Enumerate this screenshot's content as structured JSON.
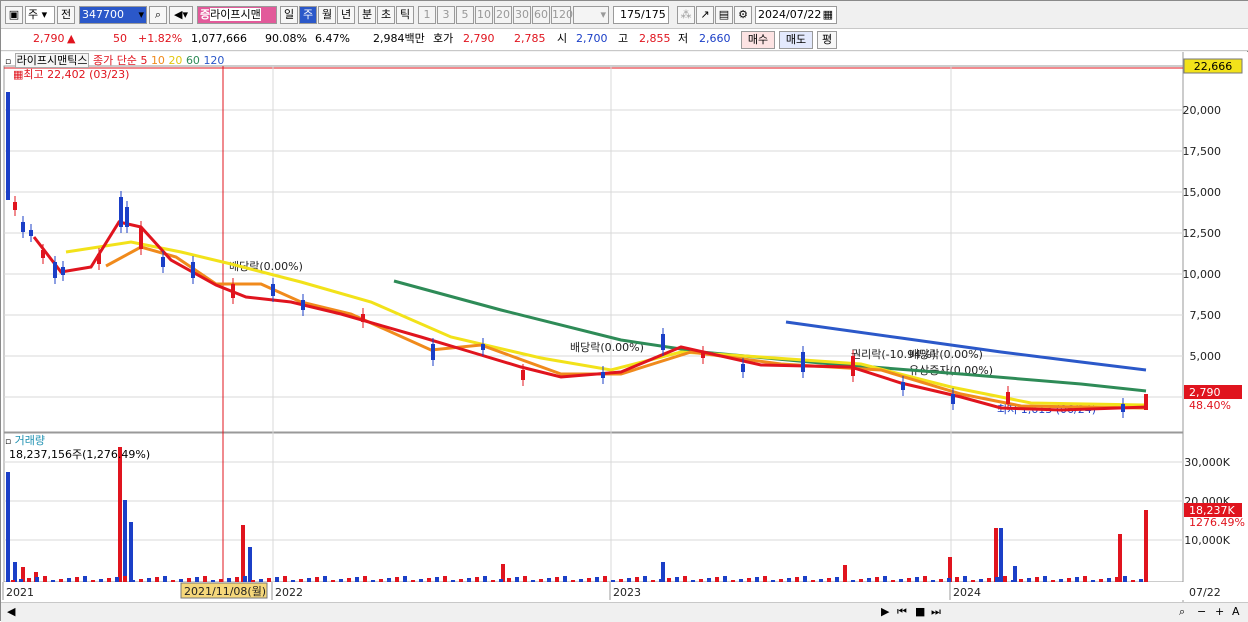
{
  "toolbar": {
    "period_type": "주",
    "prev_label": "전",
    "code_value": "347700",
    "name_badge": "증",
    "name": "라이프시맨",
    "tabs": [
      "일",
      "주",
      "월",
      "년",
      "분",
      "초",
      "틱"
    ],
    "active_tab": "주",
    "intervals": [
      "1",
      "3",
      "5",
      "10",
      "20",
      "30",
      "60",
      "120"
    ],
    "count": "175",
    "count_total": "/175",
    "date": "2024/07/22"
  },
  "quote": {
    "price": "2,790",
    "arrow": "▲",
    "change": "50",
    "change_pct": "+1.82%",
    "volume": "1,077,666",
    "vol_ratio": "90.08%",
    "turnover": "6.47%",
    "amount": "2,984백만",
    "ask_label": "호가",
    "ask": "2,790",
    "bid": "2,785",
    "open_label": "시",
    "open": "2,700",
    "high_label": "고",
    "high": "2,855",
    "low_label": "저",
    "low": "2,660",
    "buy_label": "매수",
    "sell_label": "매도",
    "eval_label": "평"
  },
  "price_panel": {
    "legend_name": "라이프시맨틱스",
    "legend_ma": "종가 단순",
    "ma_periods": [
      "5",
      "10",
      "20",
      "60",
      "120"
    ],
    "ma_colors": [
      "#e0141e",
      "#f08a1c",
      "#f2e21a",
      "#2e8b57",
      "#2b58c9"
    ],
    "high_note": "최고 22,402 (03/23)",
    "low_note": "최저 1,613 (06/24)",
    "current_top": "22,666",
    "price_tag": "2,790",
    "pct_tag": "48.40%",
    "y_ticks": [
      "20,000",
      "17,500",
      "15,000",
      "12,500",
      "10,000",
      "7,500",
      "5,000"
    ],
    "annotations": [
      "배당락(0.00%)",
      "배당락(0.00%)",
      "권리락(-10.94%)",
      "배당락(0.00%)",
      "유상증자(0.00%)"
    ]
  },
  "volume_panel": {
    "title": "거래량",
    "value": "18,237,156주(1,276.49%)",
    "y_ticks": [
      "30,000K",
      "20,000K",
      "10,000K"
    ],
    "tag_value": "18,237K",
    "tag_pct": "1276.49%"
  },
  "x_axis": {
    "labels": [
      "2021",
      "2022",
      "2023",
      "2024"
    ],
    "cursor_date": "2021/11/08(월)",
    "last_label": "07/22"
  },
  "colors": {
    "up": "#e0141e",
    "down": "#1b3fc7",
    "ma60": "#2e8b57",
    "ma120": "#2b58c9"
  }
}
